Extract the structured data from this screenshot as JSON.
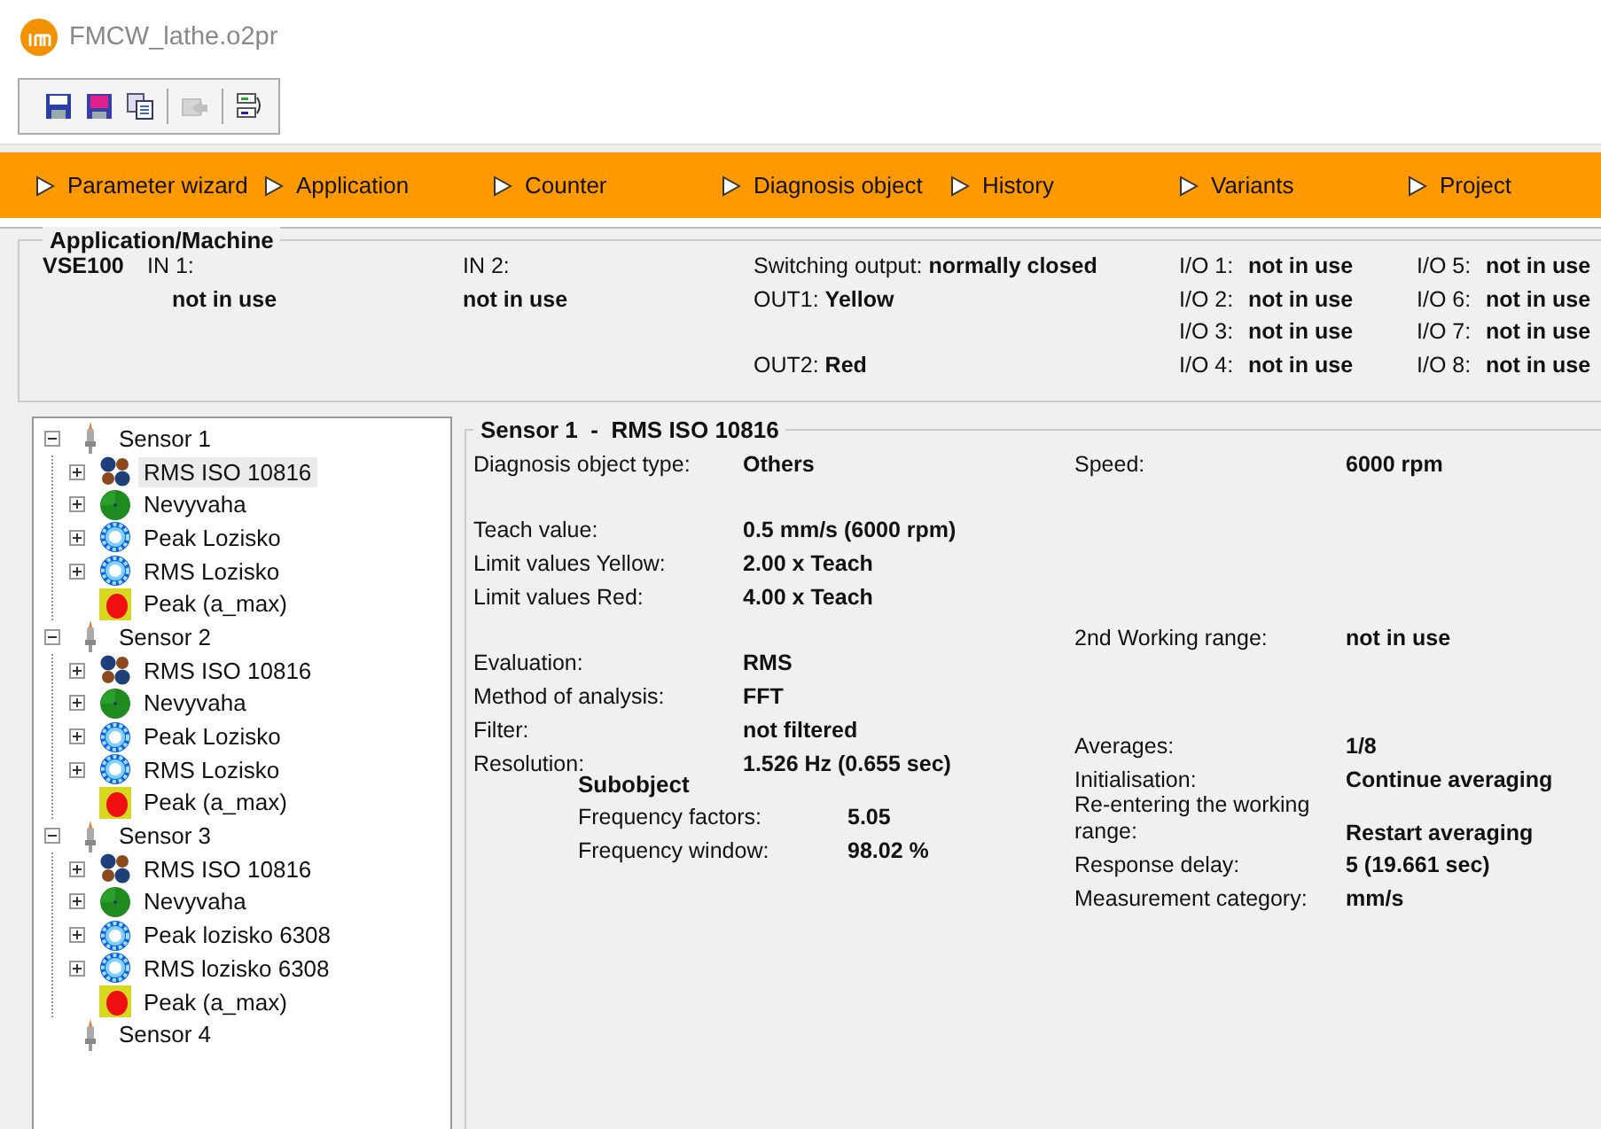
{
  "window": {
    "title": "FMCW_lathe.o2pr"
  },
  "toolbar": [
    {
      "kind": "save",
      "disabled": false
    },
    {
      "kind": "save_as",
      "disabled": false
    },
    {
      "kind": "copy",
      "disabled": false
    },
    {
      "kind": "write",
      "disabled": true
    },
    {
      "kind": "transfer",
      "disabled": false
    }
  ],
  "nav": [
    {
      "label": "Parameter wizard"
    },
    {
      "label": "Application"
    },
    {
      "label": "Counter"
    },
    {
      "label": "Diagnosis object"
    },
    {
      "label": "History"
    },
    {
      "label": "Variants"
    },
    {
      "label": "Project"
    }
  ],
  "application": {
    "title": "Application/Machine",
    "device": "VSE100",
    "inputs": [
      {
        "label": "IN 1:",
        "value": "not in use"
      },
      {
        "label": "IN 2:",
        "value": "not in use"
      }
    ],
    "switching_output": {
      "label": "Switching output:",
      "value": "normally closed"
    },
    "out1": {
      "label": "OUT1:",
      "value": "Yellow"
    },
    "out2": {
      "label": "OUT2:",
      "value": "Red"
    },
    "io": [
      {
        "label": "I/O 1:",
        "value": "not in use"
      },
      {
        "label": "I/O 2:",
        "value": "not in use"
      },
      {
        "label": "I/O 3:",
        "value": "not in use"
      },
      {
        "label": "I/O 4:",
        "value": "not in use"
      },
      {
        "label": "I/O 5:",
        "value": "not in use"
      },
      {
        "label": "I/O 6:",
        "value": "not in use"
      },
      {
        "label": "I/O 7:",
        "value": "not in use"
      },
      {
        "label": "I/O 8:",
        "value": "not in use"
      }
    ]
  },
  "tree": [
    {
      "label": "Sensor 1",
      "kind": "sensor",
      "has_children": true,
      "expanded": true,
      "selected": false,
      "children": [
        {
          "label": "RMS ISO 10816",
          "kind": "rms",
          "has_children": true,
          "expanded": false,
          "selected": true
        },
        {
          "label": "Nevyvaha",
          "kind": "unbalance",
          "has_children": true,
          "expanded": false,
          "selected": false
        },
        {
          "label": "Peak Lozisko",
          "kind": "bearing",
          "has_children": true,
          "expanded": false,
          "selected": false
        },
        {
          "label": "RMS Lozisko",
          "kind": "bearing",
          "has_children": true,
          "expanded": false,
          "selected": false
        },
        {
          "label": "Peak (a_max)",
          "kind": "peak",
          "has_children": false,
          "selected": false
        }
      ]
    },
    {
      "label": "Sensor 2",
      "kind": "sensor",
      "has_children": true,
      "expanded": true,
      "selected": false,
      "children": [
        {
          "label": "RMS ISO 10816",
          "kind": "rms",
          "has_children": true,
          "expanded": false,
          "selected": false
        },
        {
          "label": "Nevyvaha",
          "kind": "unbalance",
          "has_children": true,
          "expanded": false,
          "selected": false
        },
        {
          "label": "Peak Lozisko",
          "kind": "bearing",
          "has_children": true,
          "expanded": false,
          "selected": false
        },
        {
          "label": "RMS Lozisko",
          "kind": "bearing",
          "has_children": true,
          "expanded": false,
          "selected": false
        },
        {
          "label": "Peak (a_max)",
          "kind": "peak",
          "has_children": false,
          "selected": false
        }
      ]
    },
    {
      "label": "Sensor 3",
      "kind": "sensor",
      "has_children": true,
      "expanded": true,
      "selected": false,
      "children": [
        {
          "label": "RMS ISO 10816",
          "kind": "rms",
          "has_children": true,
          "expanded": false,
          "selected": false
        },
        {
          "label": "Nevyvaha",
          "kind": "unbalance",
          "has_children": true,
          "expanded": false,
          "selected": false
        },
        {
          "label": "Peak lozisko 6308",
          "kind": "bearing",
          "has_children": true,
          "expanded": false,
          "selected": false
        },
        {
          "label": "RMS lozisko 6308",
          "kind": "bearing",
          "has_children": true,
          "expanded": false,
          "selected": false
        },
        {
          "label": "Peak (a_max)",
          "kind": "peak",
          "has_children": false,
          "selected": false
        }
      ]
    },
    {
      "label": "Sensor 4",
      "kind": "sensor",
      "has_children": false,
      "selected": false
    }
  ],
  "details": {
    "title": "Sensor 1  -  RMS ISO 10816",
    "left_groups": [
      [
        {
          "label": "Diagnosis object type:",
          "value": "Others"
        }
      ],
      [
        {
          "label": "Teach value:",
          "value": "0.5 mm/s (6000 rpm)"
        },
        {
          "label": "Limit values Yellow:",
          "value": "2.00 x Teach"
        },
        {
          "label": "Limit values Red:",
          "value": "4.00 x Teach"
        }
      ],
      [
        {
          "label": "Evaluation:",
          "value": "RMS"
        },
        {
          "label": "Method of analysis:",
          "value": "FFT"
        },
        {
          "label": "Filter:",
          "value": "not filtered"
        },
        {
          "label": "Resolution:",
          "value": "1.526 Hz (0.655 sec)"
        }
      ]
    ],
    "subobject": {
      "title": "Subobject",
      "rows": [
        {
          "label": "Frequency factors:",
          "value": "5.05"
        },
        {
          "label": "Frequency window:",
          "value": "98.02 %"
        }
      ]
    },
    "right_groups": [
      [
        {
          "label": "Speed:",
          "value": "6000 rpm"
        }
      ],
      [
        {
          "label": "2nd Working range:",
          "value": "not in use"
        }
      ],
      [
        {
          "label": "Averages:",
          "value": "1/8"
        },
        {
          "label": "Initialisation:",
          "value": "Continue averaging"
        },
        {
          "label": "Re-entering the working range:",
          "value": "Restart averaging"
        },
        {
          "label": "Response delay:",
          "value": "5 (19.661 sec)"
        },
        {
          "label": "Measurement category:",
          "value": "mm/s"
        }
      ]
    ]
  }
}
